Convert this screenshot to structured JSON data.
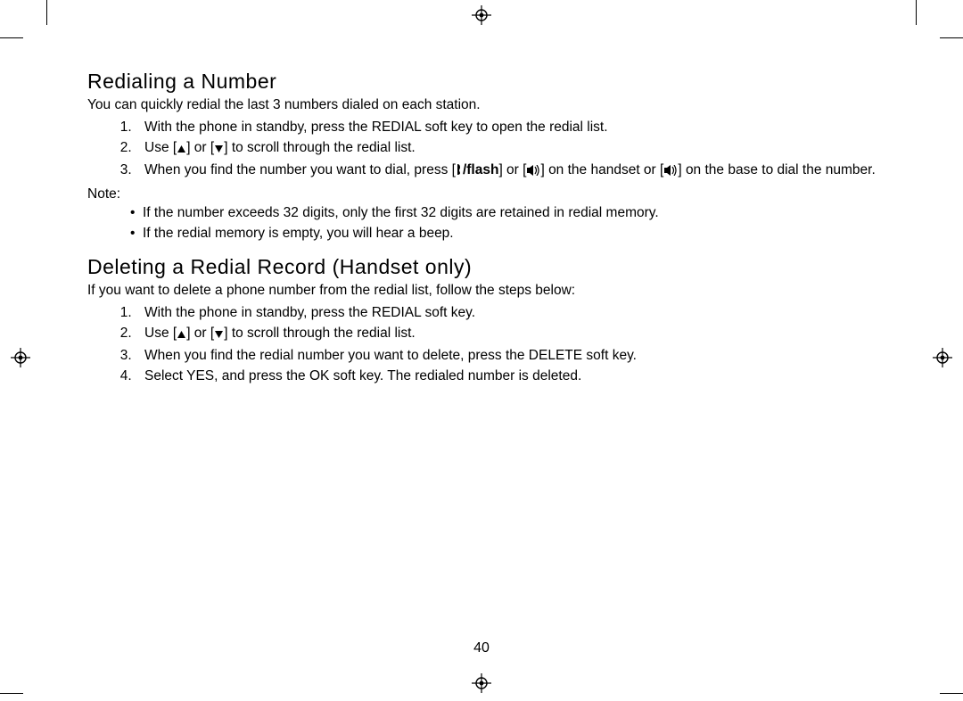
{
  "page_number": "40",
  "section1": {
    "heading": "Redialing a Number",
    "intro": "You can quickly redial the last 3 numbers dialed on each station.",
    "steps": {
      "s1": "With the phone in standby, press the REDIAL soft key to open the redial list.",
      "s2a": "Use [",
      "s2b": "] or [",
      "s2c": "] to scroll through the redial list.",
      "s3a": "When you find the number you want to dial, press [",
      "s3b": "/flash",
      "s3c": "] or [",
      "s3d": "] on the handset or [",
      "s3e": "] on the base to dial the number."
    },
    "note_label": "Note:",
    "notes": {
      "n1": "If the number exceeds 32 digits, only the first 32 digits are retained in redial memory.",
      "n2": "If the redial memory is empty, you will hear a beep."
    }
  },
  "section2": {
    "heading": "Deleting a Redial Record (Handset only)",
    "intro": "If you want to delete a phone number from the redial list, follow the steps below:",
    "steps": {
      "s1": "With the phone in standby, press the REDIAL soft key.",
      "s2a": "Use [",
      "s2b": "] or [",
      "s2c": "] to scroll through the redial list.",
      "s3": "When you find the redial number you want to delete, press the DELETE soft key.",
      "s4": "Select YES, and press the OK soft key. The redialed number is deleted."
    }
  }
}
